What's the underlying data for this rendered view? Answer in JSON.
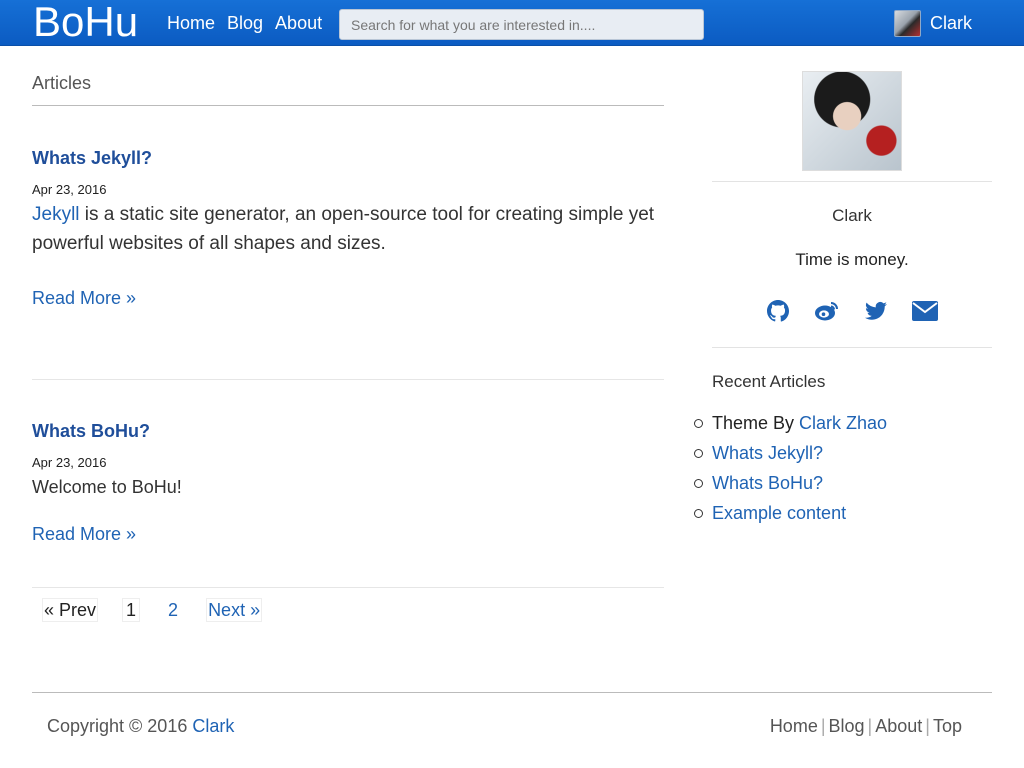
{
  "navbar": {
    "brand": "BoHu",
    "links": [
      "Home",
      "Blog",
      "About"
    ],
    "search_placeholder": "Search for what you are interested in....",
    "user_name": "Clark"
  },
  "main": {
    "section_title": "Articles",
    "posts": [
      {
        "title": "Whats Jekyll?",
        "date": "Apr 23, 2016",
        "excerpt_link": "Jekyll",
        "excerpt_text": " is a static site generator, an open-source tool for creating simple yet powerful websites of all shapes and sizes.",
        "read_more": "Read More »"
      },
      {
        "title": "Whats BoHu?",
        "date": "Apr 23, 2016",
        "excerpt_text": "Welcome to BoHu!",
        "read_more": "Read More »"
      }
    ],
    "pagination": {
      "prev": "« Prev",
      "pages": [
        "1",
        "2"
      ],
      "next": "Next »"
    }
  },
  "sidebar": {
    "profile_name": "Clark",
    "motto": "Time is money.",
    "social_icons": [
      "github-icon",
      "weibo-icon",
      "twitter-icon",
      "email-icon"
    ],
    "recent_title": "Recent Articles",
    "recent": {
      "theme_prefix": "Theme By ",
      "theme_author": "Clark Zhao",
      "items": [
        "Whats Jekyll?",
        "Whats BoHu?",
        "Example content"
      ]
    }
  },
  "footer": {
    "copyright_prefix": "Copyright © 2016 ",
    "copyright_name": "Clark",
    "links": [
      "Home",
      "Blog",
      "About",
      "Top"
    ],
    "separator": "|"
  },
  "colors": {
    "navbar": "#0b5bc2",
    "link": "#1f63b4",
    "post_title": "#1f4e9a"
  }
}
